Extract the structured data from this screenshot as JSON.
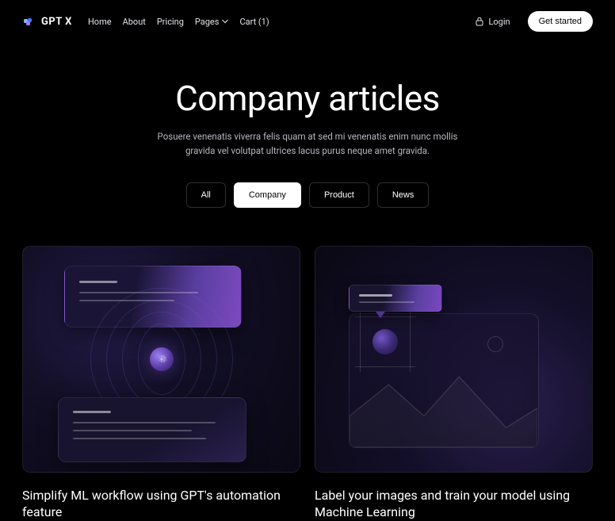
{
  "brand": {
    "name": "GPT X"
  },
  "nav": {
    "links": [
      "Home",
      "About",
      "Pricing",
      "Pages"
    ],
    "cart_label": "Cart (1)",
    "login_label": "Login",
    "cta_label": "Get started"
  },
  "hero": {
    "title": "Company articles",
    "subtitle": "Posuere venenatis viverra felis quam at sed mi venenatis enim nunc mollis gravida vel volutpat ultrices lacus purus neque amet gravida."
  },
  "tabs": {
    "items": [
      "All",
      "Company",
      "Product",
      "News"
    ],
    "active_index": 1
  },
  "articles": [
    {
      "title": "Simplify ML workflow using GPT's automation feature"
    },
    {
      "title": "Label your images and train your model using Machine Learning"
    }
  ]
}
